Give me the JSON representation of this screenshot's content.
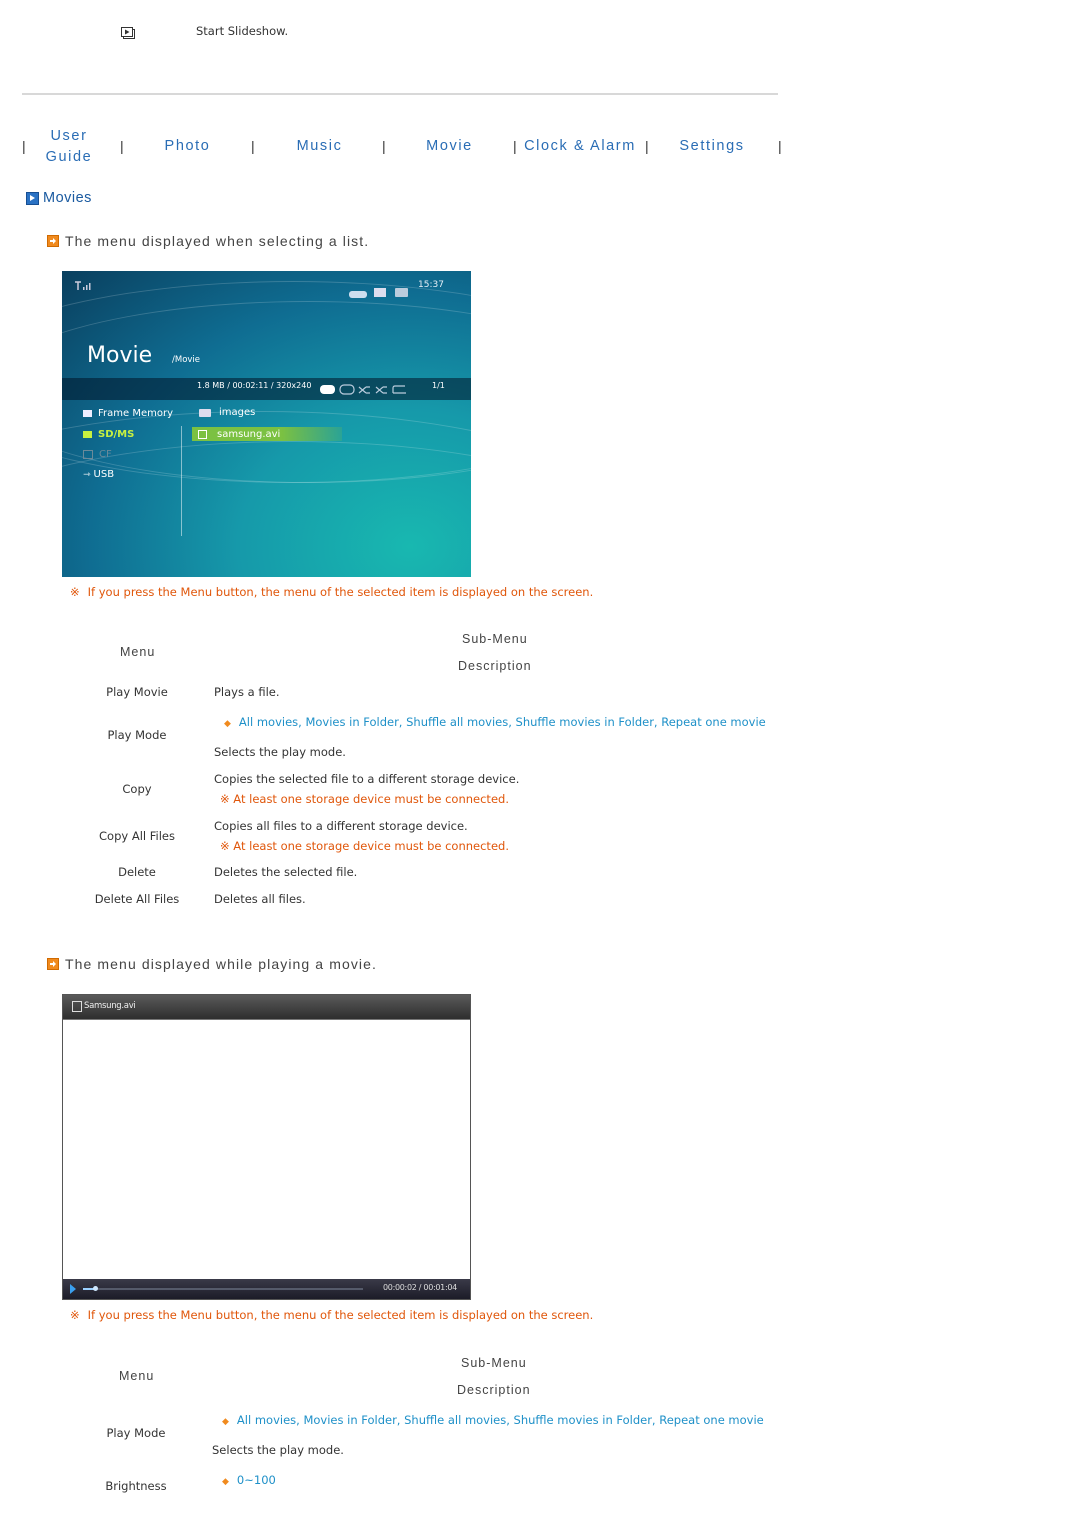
{
  "top": {
    "icon": "slideshow-icon",
    "text": "Start Slideshow."
  },
  "nav": {
    "separator": "|",
    "items": [
      {
        "label_line1": "User",
        "label_line2": "Guide"
      },
      {
        "label": "Photo"
      },
      {
        "label": "Music"
      },
      {
        "label": "Movie"
      },
      {
        "label": "Clock & Alarm"
      },
      {
        "label": "Settings"
      }
    ]
  },
  "section": {
    "icon": "play-square-icon",
    "title": "Movies"
  },
  "part1": {
    "icon": "orange-arrow-icon",
    "title": "The menu displayed when selecting a list.",
    "screen": {
      "signal_icon": "signal-icon",
      "status_icons": [
        "remote-icon",
        "card-icon",
        "usb-icon"
      ],
      "time": "15:37",
      "title": "Movie",
      "path": "/Movie",
      "info": "1.8 MB / 00:02:11 / 320x240",
      "mode_icons": [
        "repeat-all-icon",
        "repeat-folder-icon",
        "shuffle-all-icon",
        "shuffle-folder-icon",
        "repeat-one-icon"
      ],
      "page": "1/1",
      "sources": [
        {
          "label": "Frame Memory",
          "icon": "memory-icon",
          "state": "normal"
        },
        {
          "label": "SD/MS",
          "icon": "sd-card-icon",
          "state": "active"
        },
        {
          "label": "CF",
          "icon": "cf-card-icon",
          "state": "disabled"
        },
        {
          "label": "USB",
          "icon": "usb-icon",
          "state": "normal"
        }
      ],
      "files": [
        {
          "label": "images",
          "icon": "folder-icon",
          "selected": false
        },
        {
          "label": "samsung.avi",
          "icon": "film-icon",
          "selected": true
        }
      ]
    },
    "note": "If you press the Menu button, the menu of the selected item is displayed on the screen.",
    "note_mark": "※",
    "table": {
      "header_menu": "Menu",
      "header_submenu": "Sub-Menu",
      "header_description": "Description",
      "rows": [
        {
          "menu": "Play Movie",
          "description": "Plays a file."
        },
        {
          "menu": "Play Mode",
          "submenu": "All movies, Movies in Folder, Shuffle all movies, Shuffle movies in Folder, Repeat one movie",
          "description": "Selects the play mode."
        },
        {
          "menu": "Copy",
          "description": "Copies the selected file to a different storage device.",
          "note": "At least one storage device must be connected."
        },
        {
          "menu": "Copy All Files",
          "description": "Copies all files to a different storage device.",
          "note": "At least one storage device must be connected."
        },
        {
          "menu": "Delete",
          "description": "Deletes the selected file."
        },
        {
          "menu": "Delete All Files",
          "description": "Deletes all files."
        }
      ]
    }
  },
  "part2": {
    "icon": "orange-arrow-icon",
    "title": "The menu displayed while playing a movie.",
    "screen": {
      "file_icon": "film-icon",
      "filename": "Samsung.avi",
      "elapsed": "00:00:02",
      "total": "00:01:04",
      "time_display": "00:00:02 / 00:01:04",
      "progress": 0.03
    },
    "note": "If you press the Menu button, the menu of the selected item is displayed on the screen.",
    "note_mark": "※",
    "table": {
      "header_menu": "Menu",
      "header_submenu": "Sub-Menu",
      "header_description": "Description",
      "rows": [
        {
          "menu": "Play Mode",
          "submenu": "All movies, Movies in Folder, Shuffle all movies, Shuffle movies in Folder, Repeat one movie",
          "description": "Selects the play mode."
        },
        {
          "menu": "Brightness",
          "submenu": "0~100"
        }
      ]
    }
  },
  "colors": {
    "link_blue": "#2a6db5",
    "note_orange": "#e0560a",
    "submenu_cyan": "#1e90c8",
    "bullet_orange": "#f08a1e",
    "highlight_green": "#7bc142"
  }
}
